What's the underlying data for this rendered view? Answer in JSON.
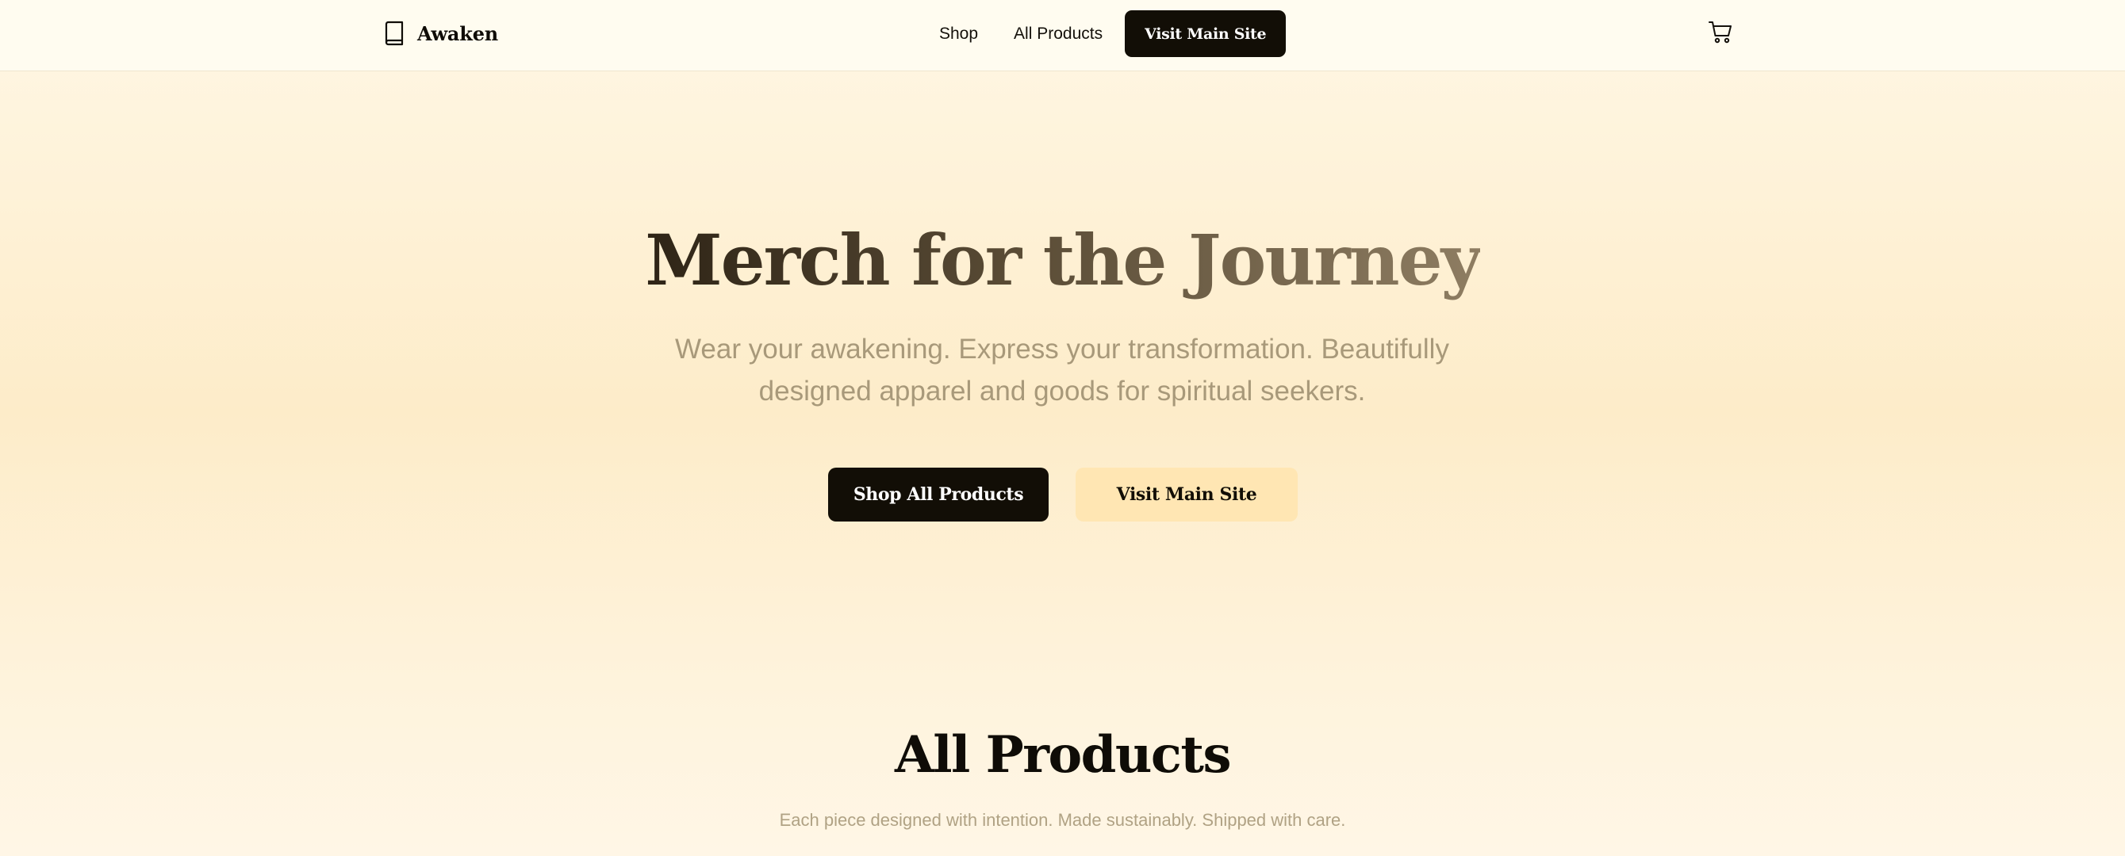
{
  "header": {
    "brand_name": "Awaken",
    "brand_icon": "book-icon",
    "nav": {
      "shop_label": "Shop",
      "all_products_label": "All Products",
      "cta_label": "Visit Main Site"
    },
    "cart_icon": "shopping-cart-icon"
  },
  "hero": {
    "title": "Merch for the Journey",
    "subtitle": "Wear your awakening. Express your transformation. Beautifully designed apparel and goods for spiritual seekers.",
    "primary_button_label": "Shop All Products",
    "secondary_button_label": "Visit Main Site"
  },
  "products_section": {
    "title": "All Products",
    "subtitle": "Each piece designed with intention. Made sustainably. Shipped with care."
  },
  "colors": {
    "header_background": "#fffcf0",
    "page_background": "#fdecc9",
    "primary_button": "#120e06",
    "secondary_button": "#ffe6b3",
    "muted_text": "#a8997a"
  }
}
